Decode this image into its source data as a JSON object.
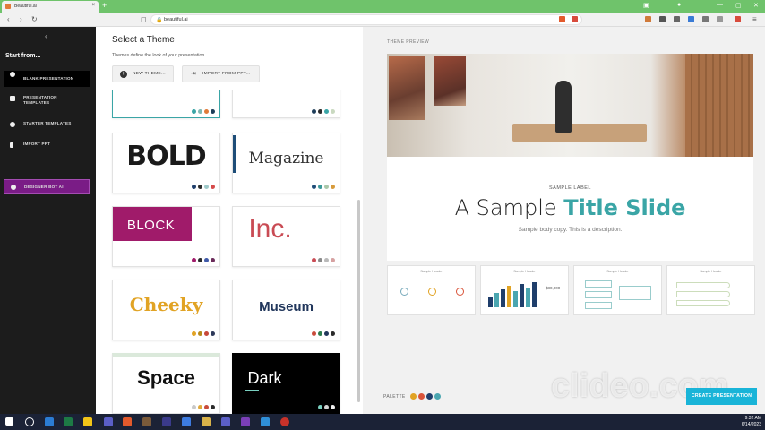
{
  "browser": {
    "tab_title": "Beautiful.ai",
    "tab_close": "×",
    "new_tab": "+",
    "url": "beautiful.ai"
  },
  "sidebar": {
    "collapse": "‹",
    "start_from": "Start from...",
    "items": [
      {
        "label": "Blank Presentation"
      },
      {
        "label": "Presentation Templates"
      },
      {
        "label": "Starter Templates"
      },
      {
        "label": "Import PPT"
      },
      {
        "label": "Designer Bot AI"
      }
    ]
  },
  "panel": {
    "title": "Select a Theme",
    "subtitle": "Themes define the look of your presentation.",
    "new_theme": "New Theme...",
    "import_ppt": "Import from PPT...",
    "themes": [
      {
        "name": "BOLD",
        "colors": [
          "#1f3e6b",
          "#2b2b2b",
          "#9ec9c9",
          "#d64b4b"
        ]
      },
      {
        "name": "Magazine",
        "colors": [
          "#1e4d78",
          "#3d9a9a",
          "#a9c7a9",
          "#d79b3b"
        ]
      },
      {
        "name": "BLOCK",
        "colors": [
          "#a01b6a",
          "#2b2b2b",
          "#3f5aa8",
          "#6a2a5a"
        ]
      },
      {
        "name": "Inc.",
        "colors": [
          "#c94b54",
          "#8a8a8a",
          "#b9b9b9",
          "#d6a1a1"
        ]
      },
      {
        "name": "Cheeky",
        "colors": [
          "#e1a324",
          "#b68a1c",
          "#c8483a",
          "#2e3a5a"
        ]
      },
      {
        "name": "Museum",
        "colors": [
          "#c94b3b",
          "#2b7d4d",
          "#22375c",
          "#2b2b2b"
        ]
      },
      {
        "name": "Space",
        "colors": [
          "#c9c9c9",
          "#e0a93b",
          "#c94b3b",
          "#2b2b2b"
        ]
      },
      {
        "name": "Dark",
        "colors": [
          "#7ad0c0",
          "#d3d3d3",
          "#f0f0f0"
        ]
      }
    ],
    "top_partial_colors_left": [
      "#3aa5a6",
      "#7fb8b3",
      "#e07b39",
      "#1e3d59"
    ],
    "top_partial_colors_right": [
      "#1e3d59",
      "#2b2b2b",
      "#3aa5a6",
      "#c9d9c0"
    ]
  },
  "preview": {
    "label": "Theme Preview",
    "slide_label": "Sample Label",
    "title_plain": "A Sample",
    "title_accent": "Title Slide",
    "body": "Sample body copy. This is a description.",
    "thumbnails": [
      {
        "title": "Sample Header"
      },
      {
        "title": "Sample Header"
      },
      {
        "title": "Sample Header"
      },
      {
        "title": "Sample Header"
      }
    ],
    "big_number": "$80,000",
    "palette_label": "Palette",
    "palette": [
      "#e1a324",
      "#d9543a",
      "#1f3e6b",
      "#4aa6b0"
    ],
    "create_button": "Create Presentation",
    "accent_color": "#3aa5a6"
  },
  "watermark": "clideo.com",
  "taskbar": {
    "time": "9:32 AM",
    "date": "6/14/2023"
  }
}
